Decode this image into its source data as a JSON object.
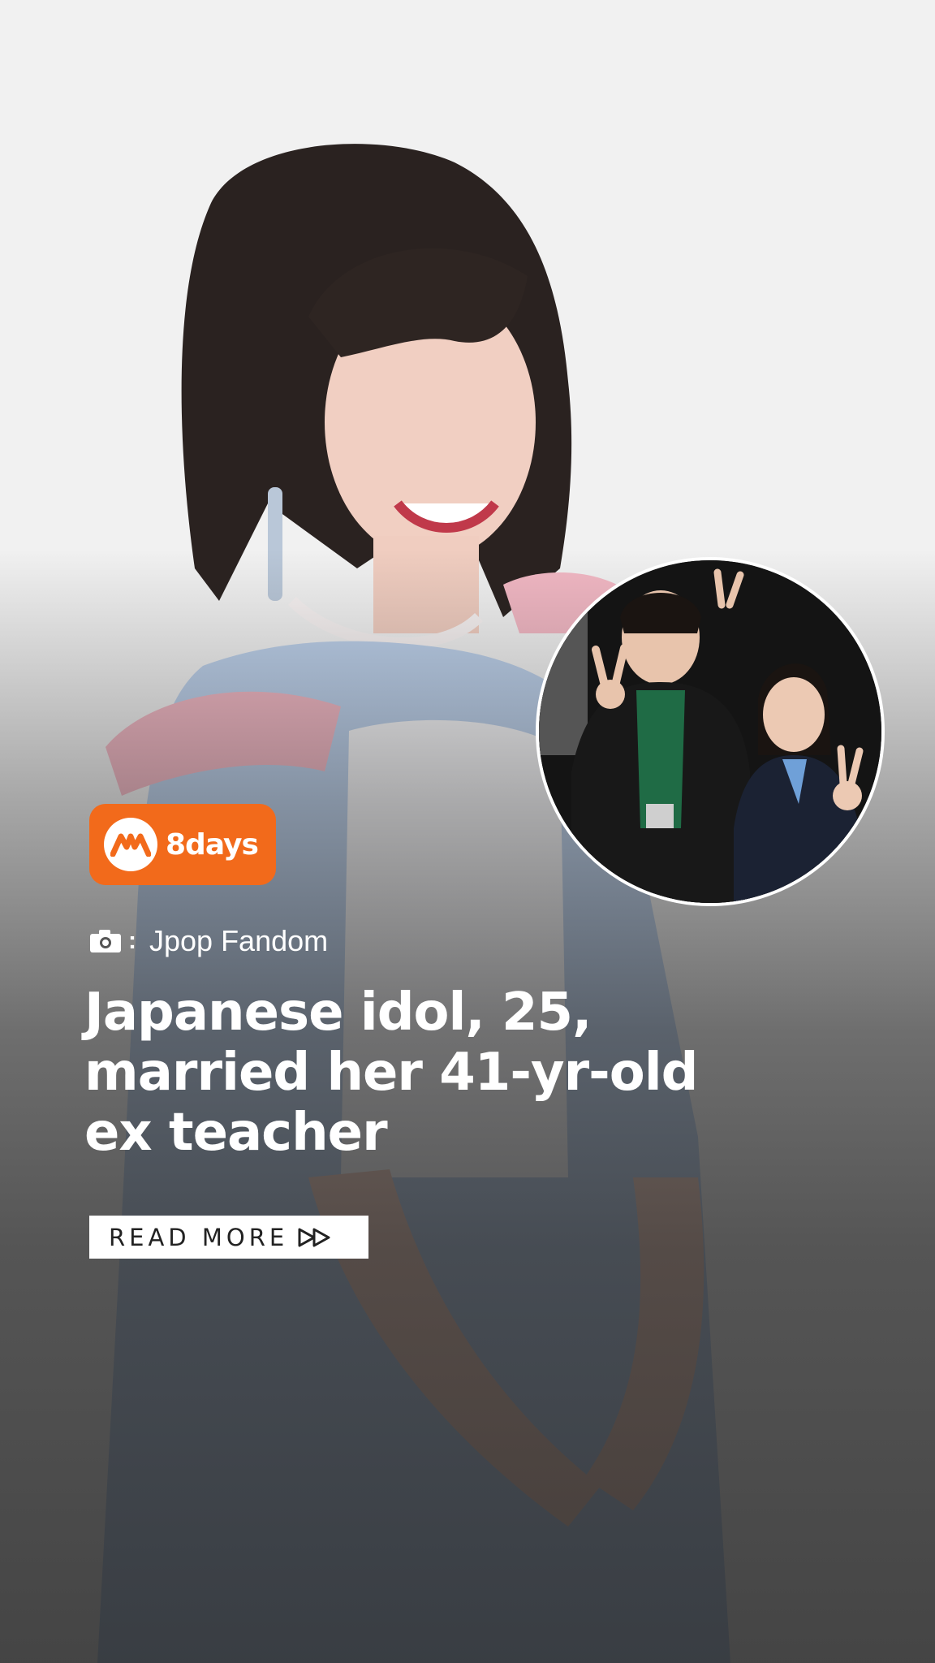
{
  "colors": {
    "brand_orange": "#f26a1b",
    "text_white": "#ffffff",
    "button_bg": "#ffffff",
    "button_text": "#222222"
  },
  "brand": {
    "logo_text": "8days",
    "logo_icon": "8days-logo-icon"
  },
  "credit": {
    "icon": "camera-icon",
    "separator": ":",
    "source": "Jpop Fandom"
  },
  "headline": {
    "lines": [
      "Japanese idol, 25,",
      "married her 41-yr-old",
      "ex teacher"
    ]
  },
  "cta": {
    "label": "READ MORE",
    "icon": "fast-forward-icon"
  }
}
